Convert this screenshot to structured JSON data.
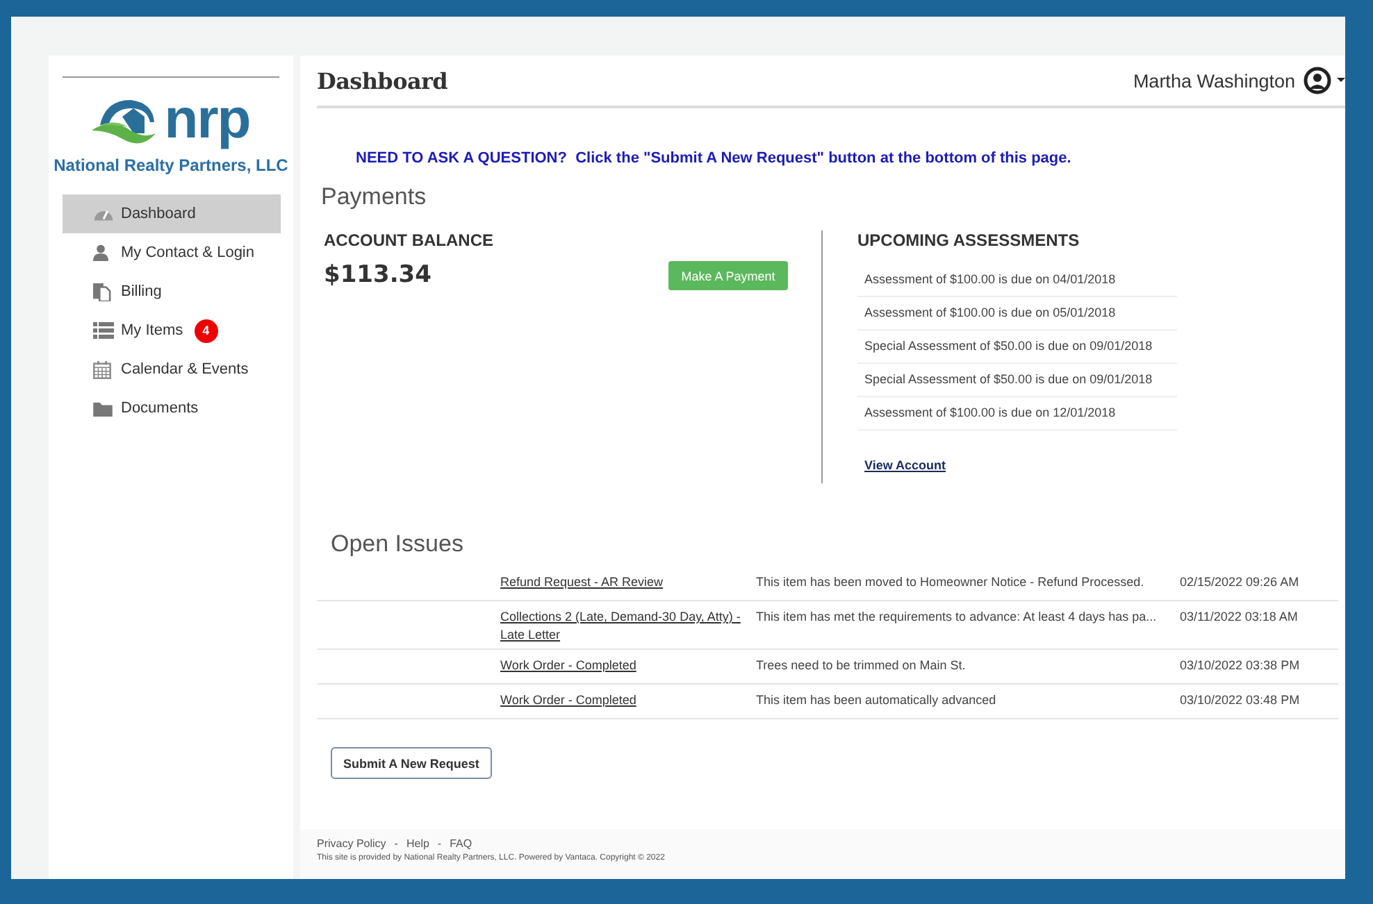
{
  "logo": {
    "wordmark": "nrp",
    "company": "National Realty Partners, LLC"
  },
  "sidebar": {
    "items": [
      {
        "label": "Dashboard",
        "selected": true
      },
      {
        "label": "My Contact & Login",
        "selected": false
      },
      {
        "label": "Billing",
        "selected": false
      },
      {
        "label": "My Items",
        "selected": false,
        "badge": "4"
      },
      {
        "label": "Calendar & Events",
        "selected": false
      },
      {
        "label": "Documents",
        "selected": false
      }
    ]
  },
  "header": {
    "title": "Dashboard",
    "user": "Martha Washington"
  },
  "notice": "NEED TO ASK A QUESTION?  Click the \"Submit A New Request\" button at the bottom of this page.",
  "payments": {
    "title": "Payments",
    "balance_label": "ACCOUNT BALANCE",
    "balance": "$113.34",
    "pay_button": "Make A Payment",
    "upcoming_title": "UPCOMING ASSESSMENTS",
    "upcoming": [
      "Assessment of $100.00 is due on 04/01/2018",
      "Assessment of $100.00 is due on 05/01/2018",
      "Special Assessment of $50.00 is due on 09/01/2018",
      "Special Assessment of $50.00 is due on 09/01/2018",
      "Assessment of $100.00 is due on 12/01/2018"
    ],
    "view_link": "View Account"
  },
  "open_issues": {
    "title": "Open Issues",
    "rows": [
      {
        "title": "Refund Request - AR Review",
        "description": "This item has been moved to Homeowner Notice - Refund Processed.",
        "date": "02/15/2022 09:26 AM"
      },
      {
        "title": "Collections 2 (Late, Demand-30 Day, Atty) - Late Letter",
        "description": "This item has met the requirements to advance: At least 4 days has pa...",
        "date": "03/11/2022 03:18 AM"
      },
      {
        "title": "Work Order - Completed",
        "description": "Trees need to be trimmed on Main St.",
        "date": "03/10/2022 03:38 PM"
      },
      {
        "title": "Work Order - Completed",
        "description": "This item has been automatically advanced",
        "date": "03/10/2022 03:48 PM"
      }
    ]
  },
  "submit_button": "Submit A New Request",
  "footer": {
    "links": [
      "Privacy Policy",
      "Help",
      "FAQ"
    ],
    "separator": "-",
    "copyright": "This site is provided by National Realty Partners, LLC. Powered by Vantaca. Copyright © 2022"
  }
}
